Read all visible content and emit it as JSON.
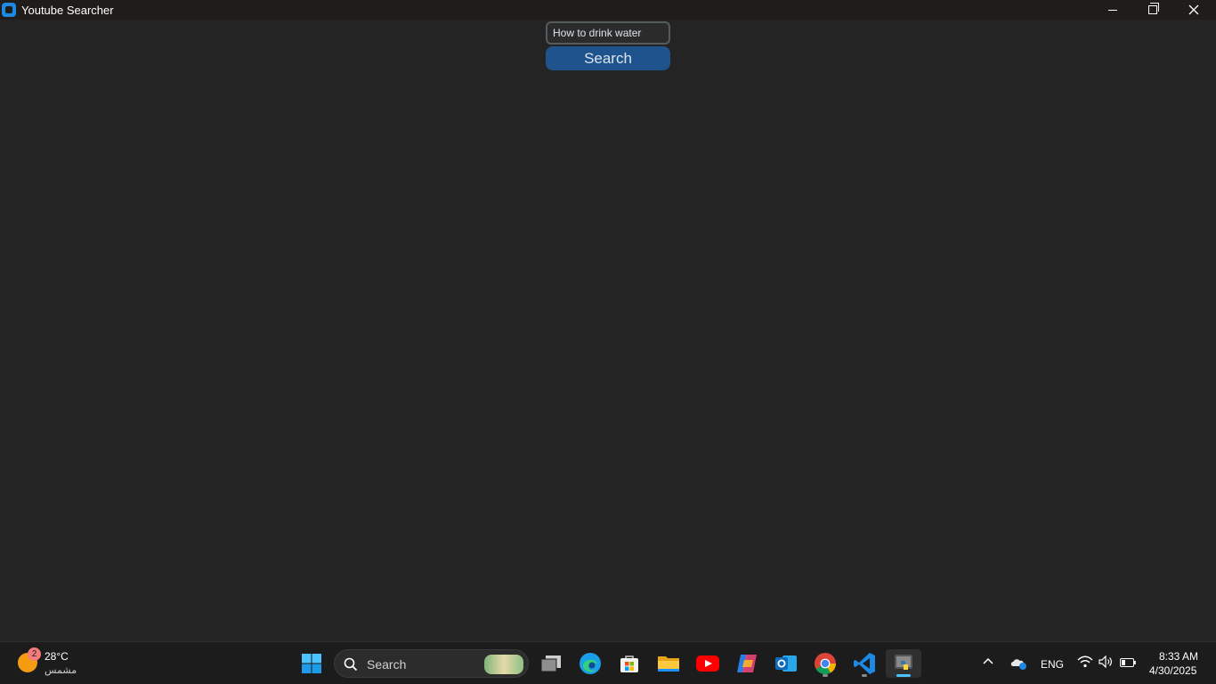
{
  "window": {
    "title": "Youtube Searcher",
    "accent": "#1f538d"
  },
  "main": {
    "search_value": "How to drink water",
    "search_button_label": "Search"
  },
  "taskbar": {
    "weather": {
      "badge": "2",
      "temp": "28°C",
      "condition": "مشمس"
    },
    "search_label": "Search",
    "apps": [
      "task-view",
      "edge",
      "microsoft-store",
      "file-explorer",
      "youtube",
      "copilot",
      "outlook",
      "chrome",
      "vscode",
      "python"
    ],
    "language": "ENG",
    "clock": {
      "time": "8:33 AM",
      "date": "4/30/2025"
    }
  }
}
